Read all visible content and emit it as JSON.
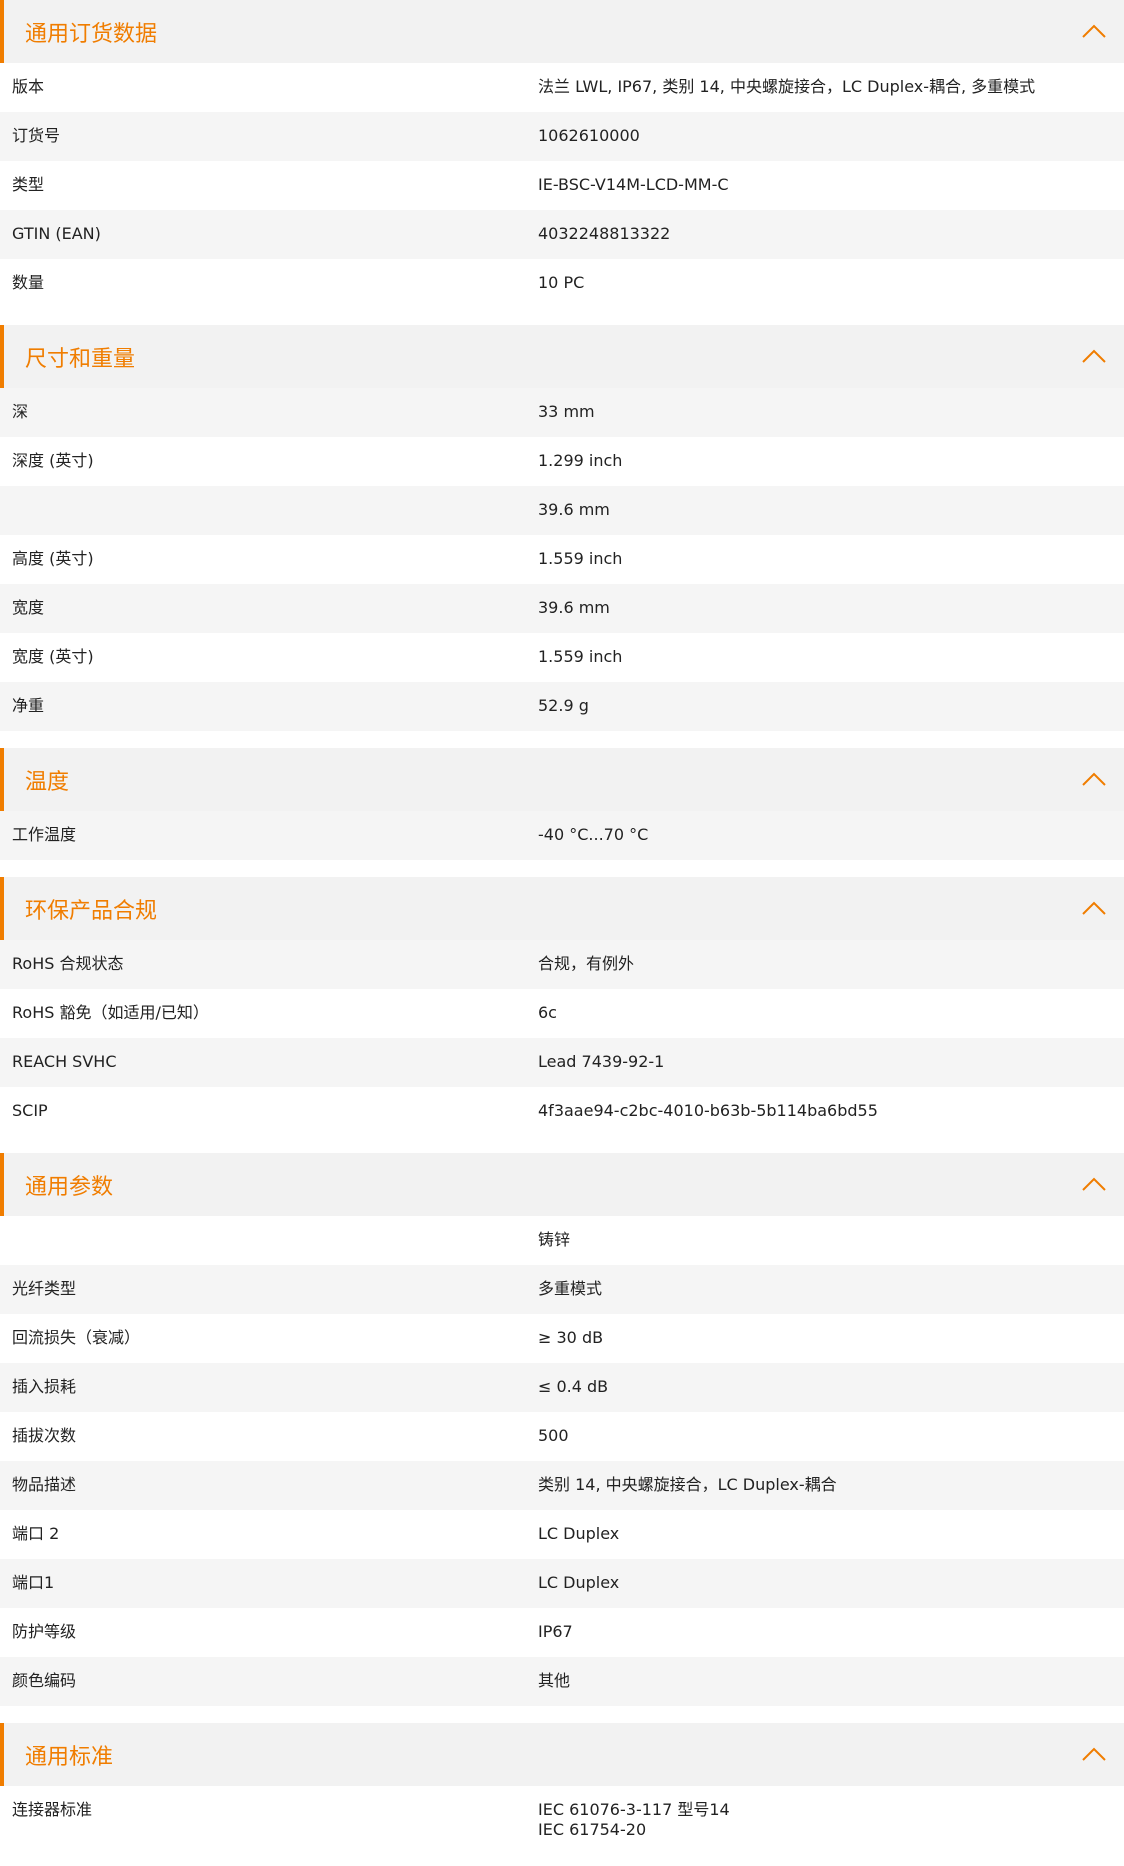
{
  "accent_color": "#f07d00",
  "sections": [
    {
      "title": "通用订货数据",
      "rows": [
        {
          "label": "版本",
          "value": "法兰 LWL, IP67, 类别 14, 中央螺旋接合，LC Duplex-耦合, 多重模式"
        },
        {
          "label": "订货号",
          "value": "1062610000"
        },
        {
          "label": "类型",
          "value": "IE-BSC-V14M-LCD-MM-C"
        },
        {
          "label": "GTIN (EAN)",
          "value": "4032248813322"
        },
        {
          "label": "数量",
          "value": "10  PC"
        }
      ]
    },
    {
      "title": "尺寸和重量",
      "rows": [
        {
          "label": "深",
          "value": "33  mm"
        },
        {
          "label": "深度 (英寸)",
          "value": "1.299  inch"
        },
        {
          "label": "",
          "value": "39.6  mm"
        },
        {
          "label": "高度 (英寸)",
          "value": "1.559  inch"
        },
        {
          "label": "宽度",
          "value": "39.6  mm"
        },
        {
          "label": "宽度 (英寸)",
          "value": "1.559  inch"
        },
        {
          "label": "净重",
          "value": "52.9  g"
        }
      ]
    },
    {
      "title": "温度",
      "rows": [
        {
          "label": "工作温度",
          "value": "-40 °C...70 °C"
        }
      ]
    },
    {
      "title": "环保产品合规",
      "rows": [
        {
          "label": "RoHS 合规状态",
          "value": "合规，有例外"
        },
        {
          "label": "RoHS 豁免（如适用/已知）",
          "value": "6c"
        },
        {
          "label": "REACH SVHC",
          "value": "Lead 7439-92-1"
        },
        {
          "label": "SCIP",
          "value": "4f3aae94-c2bc-4010-b63b-5b114ba6bd55"
        }
      ]
    },
    {
      "title": "通用参数",
      "rows": [
        {
          "label": "",
          "value": "铸锌"
        },
        {
          "label": "光纤类型",
          "value": "多重模式"
        },
        {
          "label": "回流损失（衰减）",
          "value": "≥ 30 dB"
        },
        {
          "label": "插入损耗",
          "value": "≤ 0.4 dB"
        },
        {
          "label": "插拔次数",
          "value": "500"
        },
        {
          "label": "物品描述",
          "value": "类别 14, 中央螺旋接合，LC Duplex-耦合"
        },
        {
          "label": "端口 2",
          "value": "LC Duplex"
        },
        {
          "label": "端口1",
          "value": "LC Duplex"
        },
        {
          "label": "防护等级",
          "value": "IP67"
        },
        {
          "label": "颜色编码",
          "value": "其他"
        }
      ]
    },
    {
      "title": "通用标准",
      "rows": [
        {
          "label": "连接器标准",
          "value": "IEC 61076-3-117 型号14\nIEC 61754-20"
        }
      ]
    }
  ]
}
